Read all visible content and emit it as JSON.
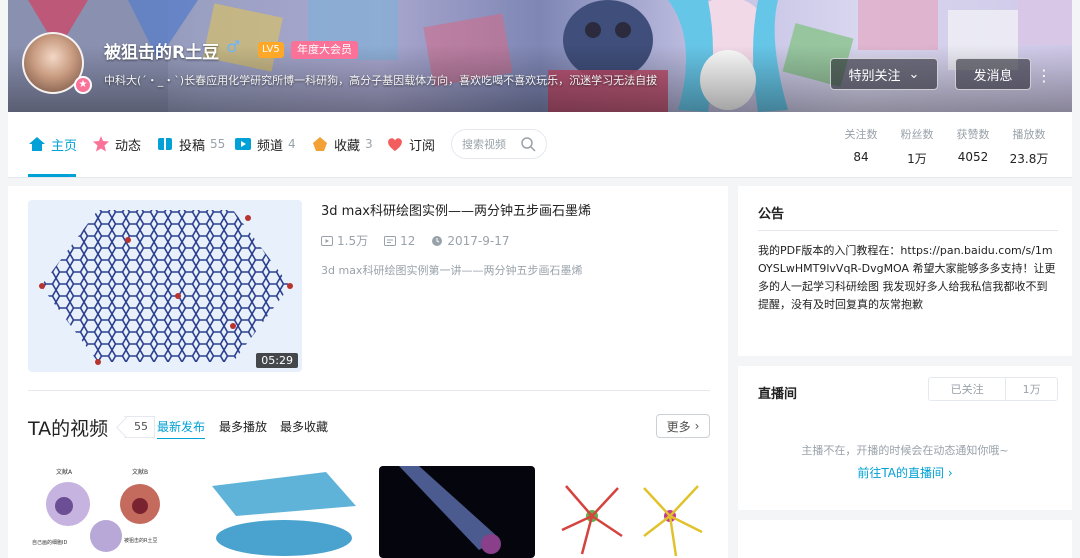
{
  "profile": {
    "username": "被狙击的R土豆",
    "gender_icon": "male-icon",
    "level": "LV5",
    "vip": "年度大会员",
    "bio": "中科大(´・_・`)长春应用化学研究所博一科研狗，高分子基因载体方向，喜欢吃喝不喜欢玩乐，沉迷学习无法自拔",
    "follow_label": "特别关注",
    "message_label": "发消息"
  },
  "nav": {
    "items": [
      {
        "label": "主页",
        "count": "",
        "icon": "home-icon"
      },
      {
        "label": "动态",
        "count": "",
        "icon": "dynamic-icon"
      },
      {
        "label": "投稿",
        "count": "55",
        "icon": "upload-icon"
      },
      {
        "label": "频道",
        "count": "4",
        "icon": "channel-icon"
      },
      {
        "label": "收藏",
        "count": "3",
        "icon": "favorite-icon"
      },
      {
        "label": "订阅",
        "count": "",
        "icon": "subscribe-icon"
      }
    ],
    "search_placeholder": "搜索视频"
  },
  "stats": [
    {
      "label": "关注数",
      "value": "84"
    },
    {
      "label": "粉丝数",
      "value": "1万"
    },
    {
      "label": "获赞数",
      "value": "4052"
    },
    {
      "label": "播放数",
      "value": "23.8万"
    }
  ],
  "featured": {
    "title": "3d max科研绘图实例——两分钟五步画石墨烯",
    "views": "1.5万",
    "comments": "12",
    "date": "2017-9-17",
    "desc": "3d max科研绘图实例第一讲——两分钟五步画石墨烯",
    "duration": "05:29"
  },
  "videos_section": {
    "title": "TA的视频",
    "count": "55",
    "tabs": [
      "最新发布",
      "最多播放",
      "最多收藏"
    ],
    "more_label": "更多",
    "thumb_labels": [
      "文献A",
      "文献B",
      "自己画的细胞ID",
      "被狙击的R土豆"
    ]
  },
  "notice": {
    "title": "公告",
    "text": "我的PDF版本的入门教程在：https://pan.baidu.com/s/1mOYSLwHMT9lvVqR-DvgMOA 希望大家能够多多支持！让更多的人一起学习科研绘图 我发现好多人给我私信我都收不到提醒，没有及时回复真的灰常抱歉"
  },
  "live": {
    "title": "直播间",
    "follow_label": "已关注",
    "follow_count": "1万",
    "message": "主播不在，开播的时候会在动态通知你哦~",
    "link": "前往TA的直播间"
  },
  "colors": {
    "accent": "#00a1d6",
    "pink": "#fb7299",
    "level": "#ffa726"
  }
}
